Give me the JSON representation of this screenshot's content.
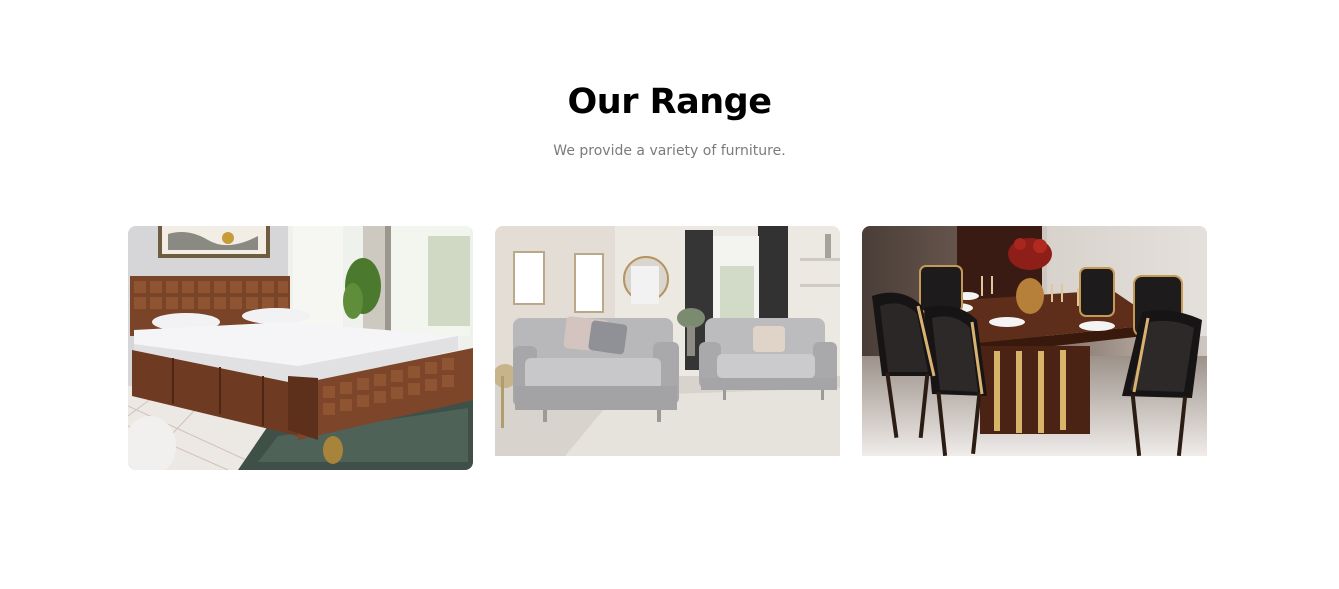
{
  "section": {
    "title": "Our Range",
    "subtitle": "We provide a variety of furniture."
  },
  "products": [
    {
      "name": "bedroom",
      "icon": "bed-image"
    },
    {
      "name": "living-room",
      "icon": "sofa-image"
    },
    {
      "name": "dining",
      "icon": "dining-table-image"
    }
  ],
  "colors": {
    "title": "#000000",
    "subtitle": "#7b7b7b",
    "background": "#ffffff"
  }
}
